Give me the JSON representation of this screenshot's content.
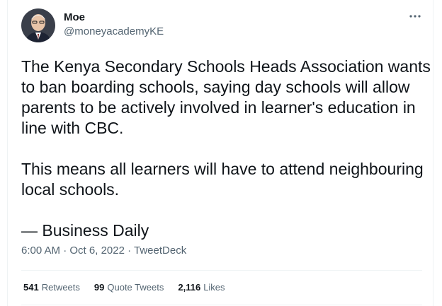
{
  "tweet": {
    "author": {
      "name": "Moe",
      "handle": "@moneyacademyKE",
      "avatar_icon": "avatar-portrait"
    },
    "more_icon": "more-dots-icon",
    "text_paragraphs": [
      "The Kenya Secondary Schools Heads Association wants to ban boarding schools, saying day schools will allow parents to be actively involved in learner's education in line with CBC.",
      "This means all learners will have to attend neighbouring local schools.",
      "— Business Daily"
    ],
    "meta": {
      "time": "6:00 AM",
      "separator": " · ",
      "date": "Oct 6, 2022",
      "source": "TweetDeck"
    },
    "stats": {
      "retweets_count": "541",
      "retweets_label": "Retweets",
      "quotes_count": "99",
      "quotes_label": "Quote Tweets",
      "likes_count": "2,116",
      "likes_label": "Likes"
    }
  },
  "colors": {
    "text_primary": "#0f1419",
    "text_secondary": "#536471",
    "divider": "#eff3f4"
  }
}
